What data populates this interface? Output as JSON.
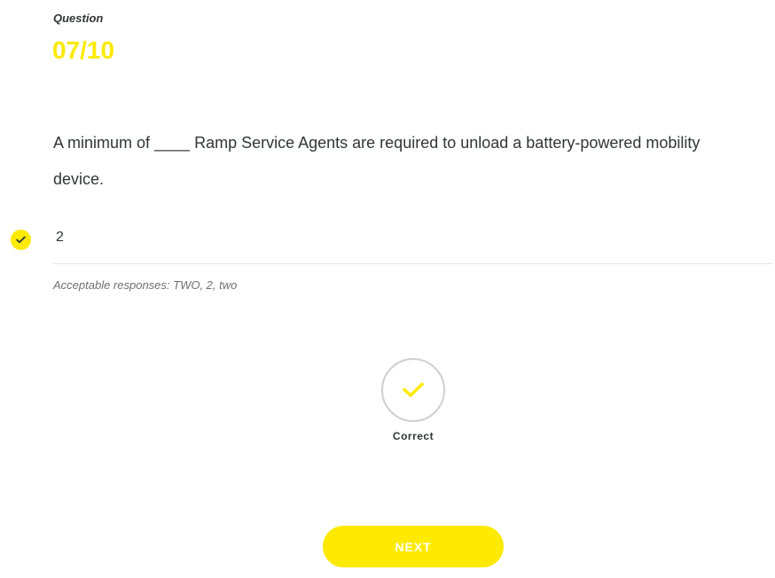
{
  "question": {
    "label": "Question",
    "number": "07/10",
    "text": "A minimum of ____ Ramp Service Agents are required to unload a battery-powered mobility device."
  },
  "answer": {
    "value": "2",
    "status_icon": "check-icon",
    "acceptable_responses": "Acceptable responses: TWO, 2, two"
  },
  "result": {
    "icon": "check-icon",
    "label": "Correct"
  },
  "actions": {
    "next_label": "NEXT"
  },
  "colors": {
    "accent": "#fdea00",
    "text": "#313537",
    "muted": "#6f6f6f",
    "divider": "#e4e4e4"
  }
}
